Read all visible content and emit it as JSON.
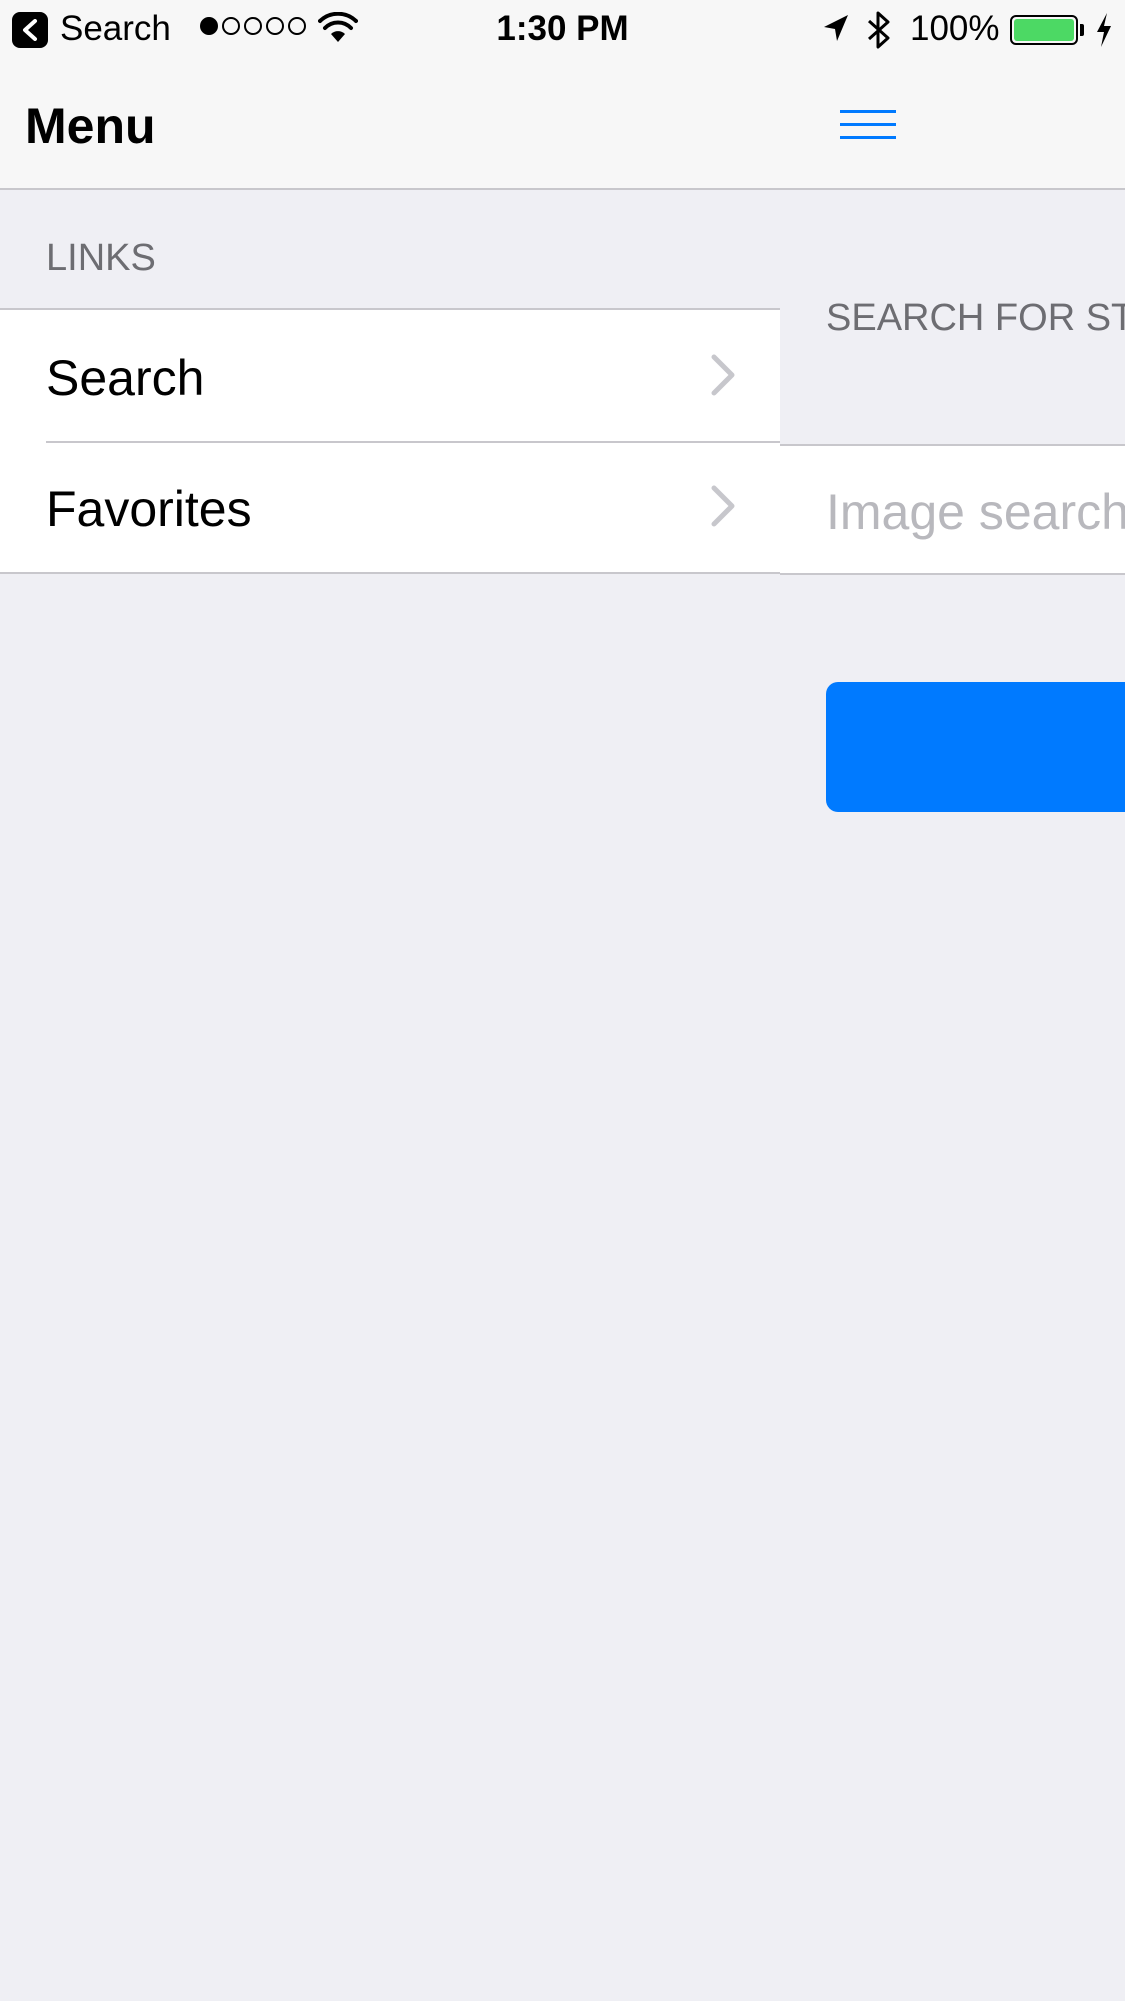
{
  "status_bar": {
    "back_label": "Search",
    "signal_filled": 1,
    "signal_total": 5,
    "time": "1:30 PM",
    "battery_percent": "100%",
    "battery_level": 1.0,
    "battery_color": "#4cd964"
  },
  "nav_bar": {
    "title": "Menu",
    "menu_icon": "hamburger-icon",
    "accent_color": "#007aff"
  },
  "menu": {
    "section_header": "LINKS",
    "items": [
      {
        "label": "Search"
      },
      {
        "label": "Favorites"
      }
    ]
  },
  "content": {
    "section_header": "SEARCH FOR ST",
    "search_placeholder": "Image search",
    "search_value": "",
    "button_color": "#007aff"
  }
}
